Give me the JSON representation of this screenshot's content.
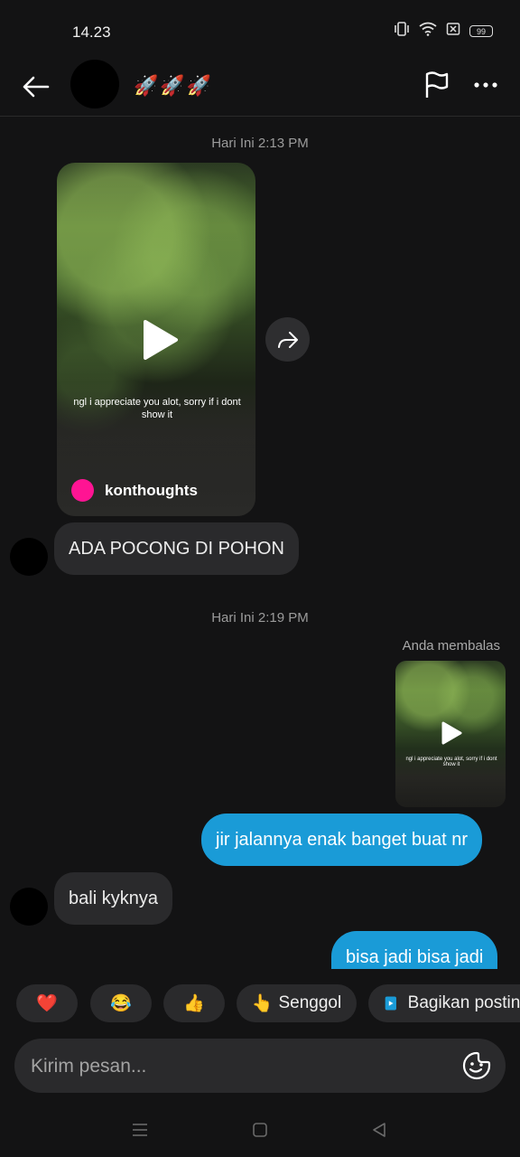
{
  "status": {
    "time": "14.23",
    "battery": "99"
  },
  "header": {
    "title": "🚀🚀🚀"
  },
  "thread": {
    "timestamp_1": "Hari Ini 2:13 PM",
    "video": {
      "caption": "ngl i appreciate you alot, sorry if i dont show it",
      "author": "konthoughts"
    },
    "msg_1": "ADA POCONG DI POHON",
    "timestamp_2": "Hari Ini 2:19 PM",
    "reply_label": "Anda membalas",
    "reply_caption": "ngl i appreciate you alot, sorry if i dont show it",
    "msg_2": "jir jalannya enak banget buat nr",
    "msg_3": "bali kyknya",
    "msg_4": "bisa jadi bisa jadi"
  },
  "quick_replies": {
    "heart": "❤️",
    "laugh": "😂",
    "thumbs": "👍",
    "poke_emoji": "👆",
    "poke_label": "Senggol",
    "share_label": "Bagikan postingan"
  },
  "compose": {
    "placeholder": "Kirim pesan..."
  }
}
